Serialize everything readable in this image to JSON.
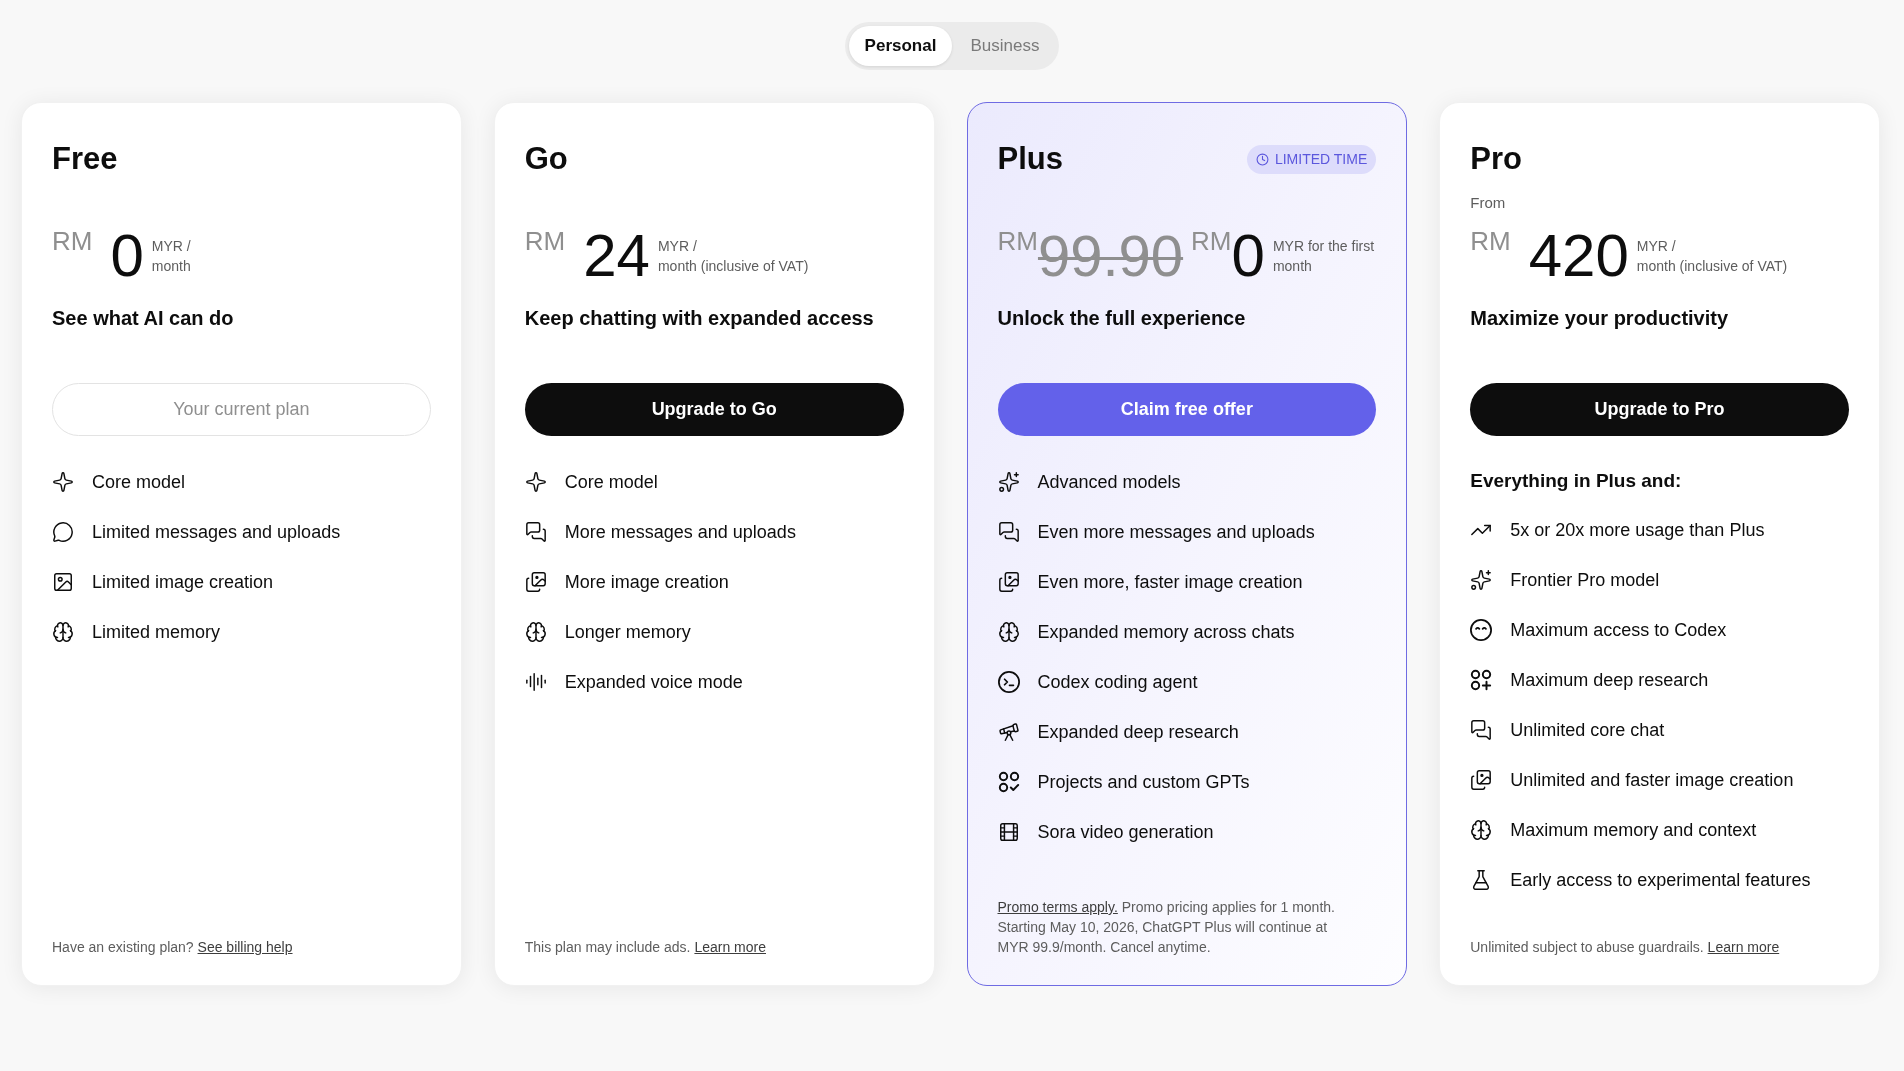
{
  "plan_toggle": [
    {
      "label": "Personal",
      "selected": true
    },
    {
      "label": "Business",
      "selected": false
    }
  ],
  "plans": [
    {
      "name": "Free",
      "highlighted": false,
      "price": {
        "currency": "RM",
        "amount": "0",
        "unit_lines": [
          "MYR /",
          "month"
        ]
      },
      "tagline": "See what AI can do",
      "button": {
        "label": "Your current plan",
        "kind": "current"
      },
      "features": [
        "Core model",
        "Limited messages and uploads",
        "Limited image creation",
        "Limited memory"
      ],
      "footer": [
        {
          "kind": "text",
          "text": "Have an existing plan?"
        },
        {
          "kind": "link",
          "text": "See billing help"
        }
      ]
    },
    {
      "name": "Go",
      "highlighted": false,
      "price": {
        "currency": "RM",
        "amount": "24",
        "unit_lines": [
          "MYR /",
          "month (inclusive of VAT)"
        ]
      },
      "tagline": "Keep chatting with expanded access",
      "button": {
        "label": "Upgrade to Go",
        "kind": "primary"
      },
      "features": [
        "Core model",
        "More messages and uploads",
        "More image creation",
        "Longer memory",
        "Expanded voice mode"
      ],
      "footer": [
        {
          "kind": "text",
          "text": "This plan may include ads."
        },
        {
          "kind": "link",
          "text": "Learn more"
        }
      ]
    },
    {
      "name": "Plus",
      "highlighted": true,
      "badge": "LIMITED TIME",
      "price": {
        "old_currency": "RM",
        "old_amount": "99.90",
        "currency": "RM",
        "amount": "0",
        "unit_lines": [
          "MYR for the first",
          "month"
        ]
      },
      "tagline": "Unlock the full experience",
      "button": {
        "label": "Claim free offer",
        "kind": "accent"
      },
      "features": [
        "Advanced models",
        "Even more messages and uploads",
        "Even more, faster image creation",
        "Expanded memory across chats",
        "Codex coding agent",
        "Expanded deep research",
        "Projects and custom GPTs",
        "Sora video generation"
      ],
      "footer": [
        {
          "kind": "link",
          "text": "Promo terms apply."
        },
        {
          "kind": "text",
          "text": "Promo pricing applies for 1 month. Starting May 10, 2026, ChatGPT Plus will continue at MYR 99.9/month. Cancel anytime."
        }
      ]
    },
    {
      "name": "Pro",
      "highlighted": false,
      "price_prefix": "From",
      "price": {
        "currency": "RM",
        "amount": "420",
        "unit_lines": [
          "MYR /",
          "month (inclusive of VAT)"
        ]
      },
      "tagline": "Maximize your productivity",
      "button": {
        "label": "Upgrade to Pro",
        "kind": "primary"
      },
      "features_heading": "Everything in Plus and:",
      "features": [
        "5x or 20x more usage than Plus",
        "Frontier Pro model",
        "Maximum access to Codex",
        "Maximum deep research",
        "Unlimited core chat",
        "Unlimited and faster image creation",
        "Maximum memory and context",
        "Early access to experimental features"
      ],
      "footer": [
        {
          "kind": "text",
          "text": "Unlimited subject to abuse guardrails."
        },
        {
          "kind": "link",
          "text": "Learn more"
        }
      ]
    }
  ]
}
